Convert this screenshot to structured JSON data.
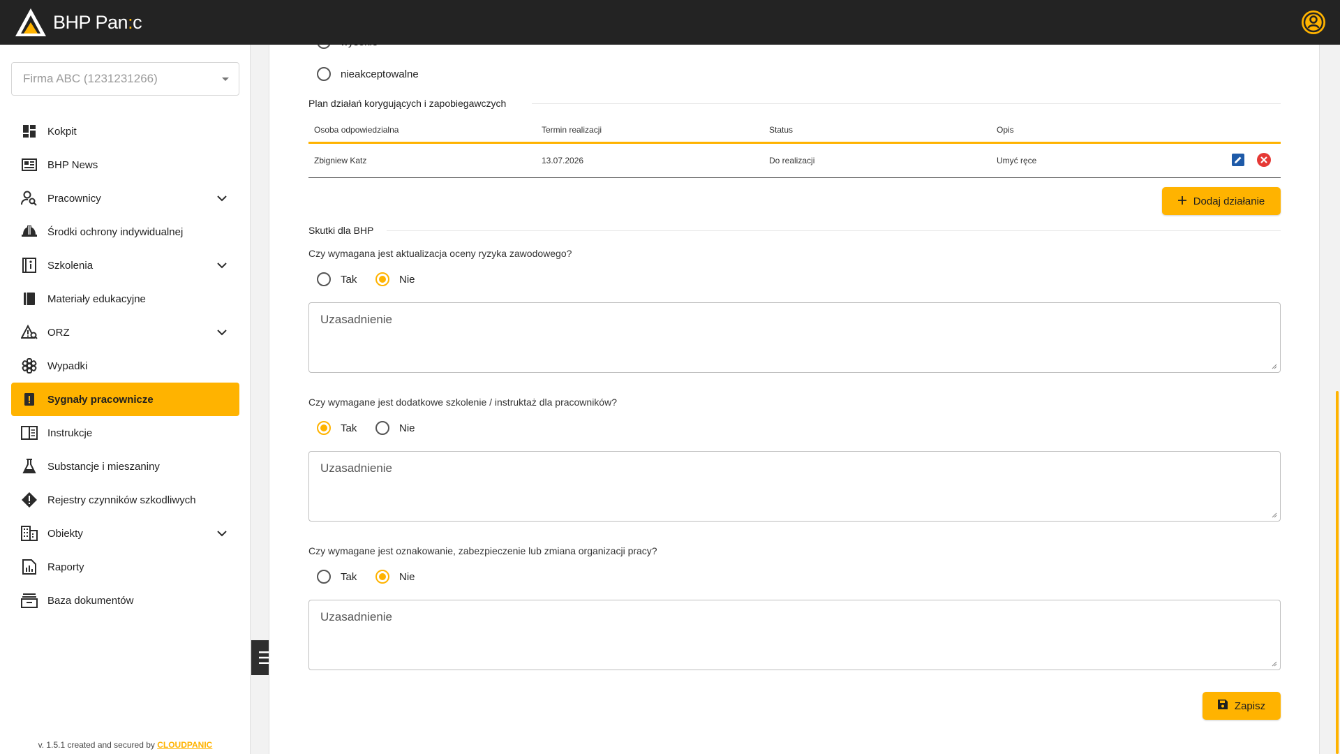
{
  "header": {
    "brand_main": "BHP Pan",
    "brand_accent": ":",
    "brand_end": "c",
    "user_icon": "account-circle-icon"
  },
  "sidebar": {
    "company": "Firma ABC (1231231266)",
    "items": [
      {
        "label": "Kokpit",
        "icon": "dashboard-icon"
      },
      {
        "label": "BHP News",
        "icon": "news-icon"
      },
      {
        "label": "Pracownicy",
        "icon": "person-search-icon",
        "expandable": true
      },
      {
        "label": "Środki ochrony indywidualnej",
        "icon": "helmet-icon"
      },
      {
        "label": "Szkolenia",
        "icon": "training-book-icon",
        "expandable": true
      },
      {
        "label": "Materiały edukacyjne",
        "icon": "book-icon"
      },
      {
        "label": "ORZ",
        "icon": "risk-triangle-icon",
        "expandable": true
      },
      {
        "label": "Wypadki",
        "icon": "medical-cross-icon"
      },
      {
        "label": "Sygnały pracownicze",
        "icon": "alert-box-icon",
        "active": true
      },
      {
        "label": "Instrukcje",
        "icon": "open-book-icon"
      },
      {
        "label": "Substancje i mieszaniny",
        "icon": "flask-icon"
      },
      {
        "label": "Rejestry czynników szkodliwych",
        "icon": "warning-diamond-icon"
      },
      {
        "label": "Obiekty",
        "icon": "building-icon",
        "expandable": true
      },
      {
        "label": "Raporty",
        "icon": "report-chart-icon"
      },
      {
        "label": "Baza dokumentów",
        "icon": "archive-icon"
      }
    ],
    "footer_prefix": "v. 1.5.1 created and secured by ",
    "footer_link": "CLOUDPANIC"
  },
  "content": {
    "partial_radio": "wysokie",
    "radio_unacceptable": "nieakceptowalne",
    "plan_title": "Plan działań korygujących i zapobiegawczych",
    "table": {
      "headers": [
        "Osoba odpowiedzialna",
        "Termin realizacji",
        "Status",
        "Opis"
      ],
      "rows": [
        [
          "Zbigniew Katz",
          "13.07.2026",
          "Do realizacji",
          "Umyć ręce"
        ]
      ]
    },
    "add_action_label": "Dodaj działanie",
    "effects_title": "Skutki dla BHP",
    "questions": [
      {
        "text": "Czy wymagana jest aktualizacja oceny ryzyka zawodowego?",
        "selected": "Nie"
      },
      {
        "text": "Czy wymagane jest dodatkowe szkolenie / instruktaż dla pracowników?",
        "selected": "Tak"
      },
      {
        "text": "Czy wymagane jest oznakowanie, zabezpieczenie lub zmiana organizacji pracy?",
        "selected": "Nie"
      }
    ],
    "yes_label": "Tak",
    "no_label": "Nie",
    "justification_placeholder": "Uzasadnienie",
    "save_label": "Zapisz"
  },
  "colors": {
    "accent": "#ffb300",
    "header_bg": "#232323",
    "edit_blue": "#1e5aa8",
    "delete_red": "#e53935"
  }
}
